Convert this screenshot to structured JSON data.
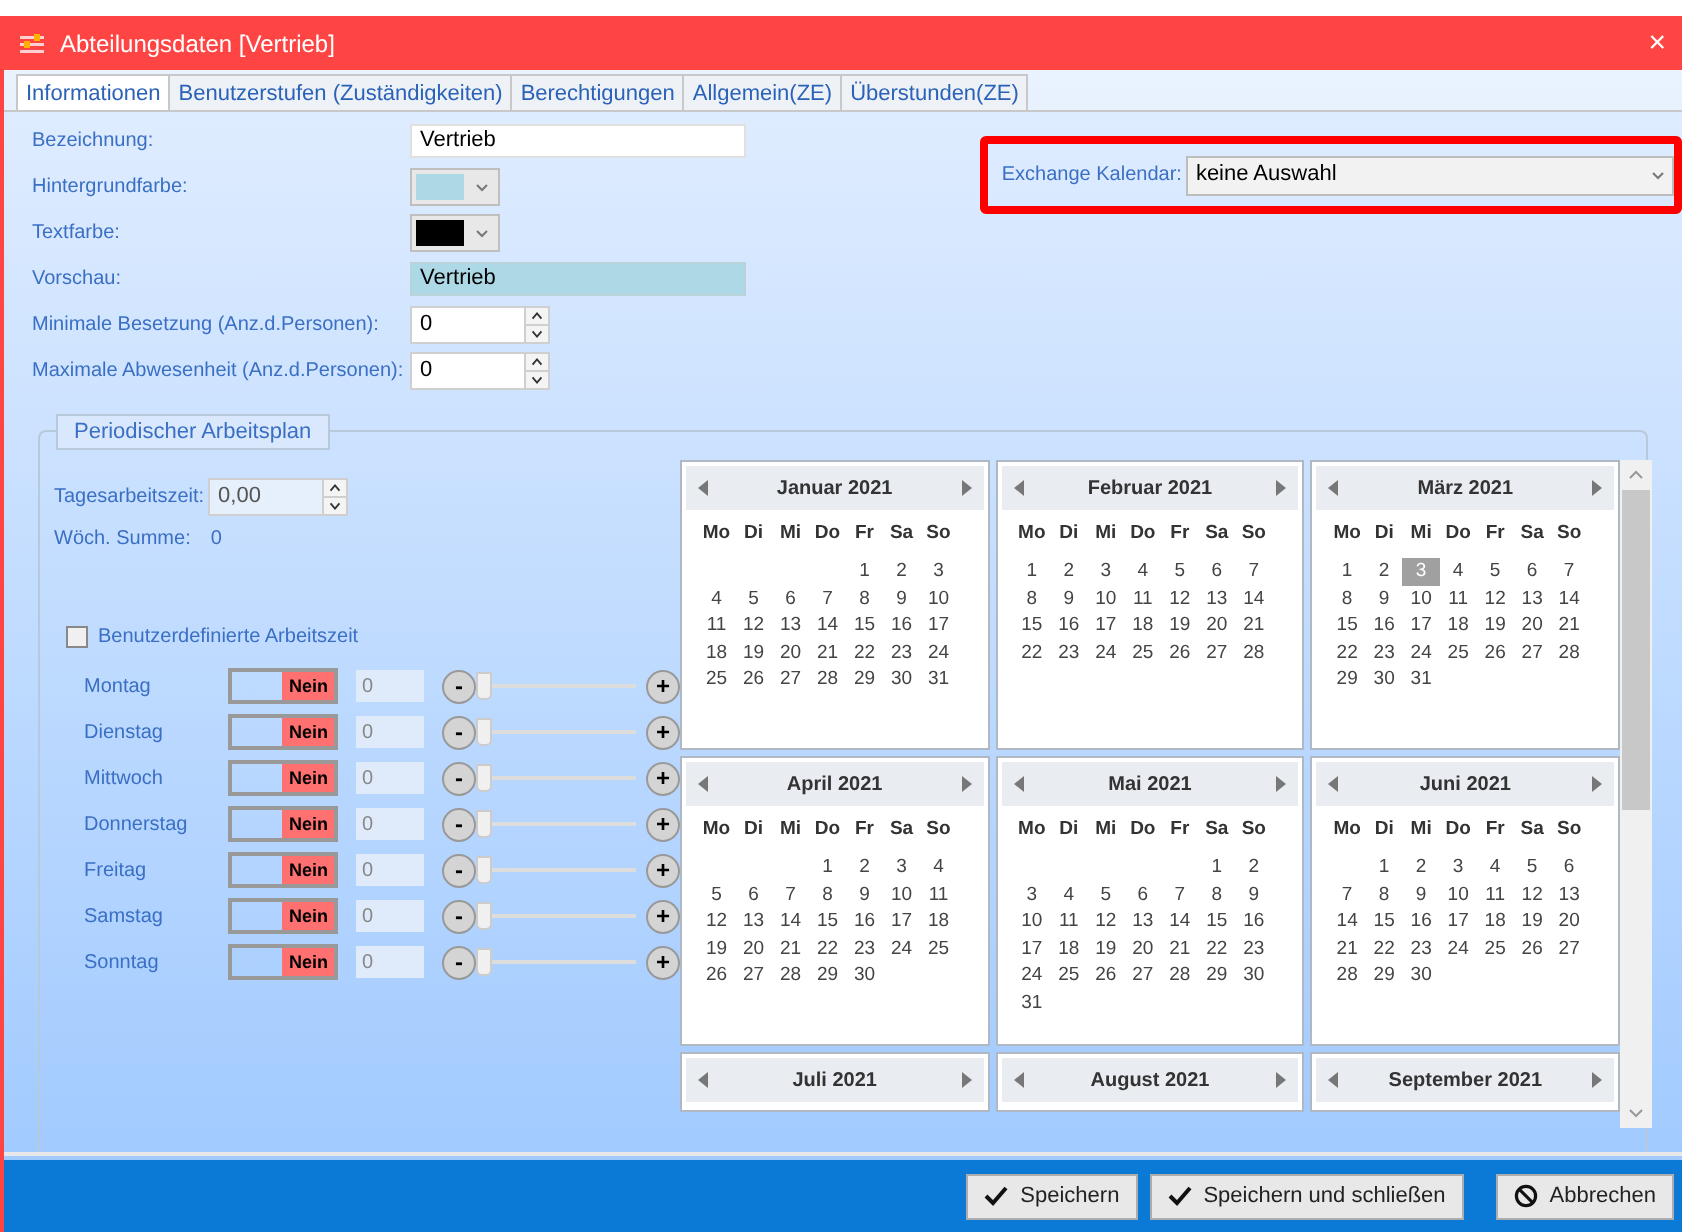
{
  "window": {
    "title": "Abteilungsdaten [Vertrieb]",
    "close": "×"
  },
  "tabs": [
    {
      "label": "Informationen",
      "selected": true
    },
    {
      "label": "Benutzerstufen (Zuständigkeiten)",
      "selected": false
    },
    {
      "label": "Berechtigungen",
      "selected": false
    },
    {
      "label": "Allgemein(ZE)",
      "selected": false
    },
    {
      "label": "Überstunden(ZE)",
      "selected": false
    }
  ],
  "form": {
    "bezeichnung": {
      "label": "Bezeichnung:",
      "value": "Vertrieb"
    },
    "hintergrundfarbe": {
      "label": "Hintergrundfarbe:",
      "color": "#add8e6"
    },
    "textfarbe": {
      "label": "Textfarbe:",
      "color": "#000000"
    },
    "vorschau": {
      "label": "Vorschau:",
      "value": "Vertrieb"
    },
    "min_besetzung": {
      "label": "Minimale Besetzung (Anz.d.Personen):",
      "value": "0"
    },
    "max_abwesenheit": {
      "label": "Maximale Abwesenheit (Anz.d.Personen):",
      "value": "0"
    }
  },
  "exchange": {
    "label": "Exchange Kalendar:",
    "value": "keine Auswahl"
  },
  "arbeitsplan": {
    "title": "Periodischer Arbeitsplan",
    "tagesarbeitszeit": {
      "label": "Tagesarbeitszeit:",
      "value": "0,00"
    },
    "woch_summe": {
      "label": "Wöch. Summe:",
      "value": "0"
    },
    "custom": {
      "label": "Benutzerdefinierte Arbeitszeit",
      "checked": false
    },
    "days": [
      {
        "name": "Montag",
        "on": false,
        "toggle": "Nein",
        "placeholder": "0",
        "minus": "-",
        "plus": "+",
        "level": 0
      },
      {
        "name": "Dienstag",
        "on": false,
        "toggle": "Nein",
        "placeholder": "0",
        "minus": "-",
        "plus": "+",
        "level": 0
      },
      {
        "name": "Mittwoch",
        "on": false,
        "toggle": "Nein",
        "placeholder": "0",
        "minus": "-",
        "plus": "+",
        "level": 0
      },
      {
        "name": "Donnerstag",
        "on": false,
        "toggle": "Nein",
        "placeholder": "0",
        "minus": "-",
        "plus": "+",
        "level": 0
      },
      {
        "name": "Freitag",
        "on": false,
        "toggle": "Nein",
        "placeholder": "0",
        "minus": "-",
        "plus": "+",
        "level": 0
      },
      {
        "name": "Samstag",
        "on": false,
        "toggle": "Nein",
        "placeholder": "0",
        "minus": "-",
        "plus": "+",
        "level": 0
      },
      {
        "name": "Sonntag",
        "on": false,
        "toggle": "Nein",
        "placeholder": "0",
        "minus": "-",
        "plus": "+",
        "level": 0
      }
    ]
  },
  "calendar": {
    "months": [
      {
        "title": "Januar 2021",
        "weekdays": [
          "Mo",
          "Di",
          "Mi",
          "Do",
          "Fr",
          "Sa",
          "So"
        ],
        "weeks": [
          [
            "1",
            "2",
            "3"
          ],
          [
            "4",
            "5",
            "6",
            "7",
            "8",
            "9",
            "10"
          ],
          [
            "11",
            "12",
            "13",
            "14",
            "15",
            "16",
            "17"
          ],
          [
            "18",
            "19",
            "20",
            "21",
            "22",
            "23",
            "24"
          ],
          [
            "25",
            "26",
            "27",
            "28",
            "29",
            "30",
            "31"
          ]
        ]
      },
      {
        "title": "Februar 2021",
        "weekdays": [
          "Mo",
          "Di",
          "Mi",
          "Do",
          "Fr",
          "Sa",
          "So"
        ],
        "weeks": [
          [
            "1",
            "2",
            "3",
            "4",
            "5",
            "6",
            "7"
          ],
          [
            "8",
            "9",
            "10",
            "11",
            "12",
            "13",
            "14"
          ],
          [
            "15",
            "16",
            "17",
            "18",
            "19",
            "20",
            "21"
          ],
          [
            "22",
            "23",
            "24",
            "25",
            "26",
            "27",
            "28"
          ]
        ]
      },
      {
        "title": "März 2021",
        "weekdays": [
          "Mo",
          "Di",
          "Mi",
          "Do",
          "Fr",
          "Sa",
          "So"
        ],
        "weeks": [
          [
            "1",
            "2",
            {
              "day": "3",
              "selected": true
            },
            "4",
            "5",
            "6",
            "7"
          ],
          [
            "8",
            "9",
            "10",
            "11",
            "12",
            "13",
            "14"
          ],
          [
            "15",
            "16",
            "17",
            "18",
            "19",
            "20",
            "21"
          ],
          [
            "22",
            "23",
            "24",
            "25",
            "26",
            "27",
            "28"
          ],
          [
            "29",
            "30",
            "31"
          ]
        ]
      },
      {
        "title": "April 2021",
        "weekdays": [
          "Mo",
          "Di",
          "Mi",
          "Do",
          "Fr",
          "Sa",
          "So"
        ],
        "weeks": [
          [
            "1",
            "2",
            "3",
            "4"
          ],
          [
            "5",
            "6",
            "7",
            "8",
            "9",
            "10",
            "11"
          ],
          [
            "12",
            "13",
            "14",
            "15",
            "16",
            "17",
            "18"
          ],
          [
            "19",
            "20",
            "21",
            "22",
            "23",
            "24",
            "25"
          ],
          [
            "26",
            "27",
            "28",
            "29",
            "30"
          ]
        ]
      },
      {
        "title": "Mai 2021",
        "weekdays": [
          "Mo",
          "Di",
          "Mi",
          "Do",
          "Fr",
          "Sa",
          "So"
        ],
        "weeks": [
          [
            "1",
            "2"
          ],
          [
            "3",
            "4",
            "5",
            "6",
            "7",
            "8",
            "9"
          ],
          [
            "10",
            "11",
            "12",
            "13",
            "14",
            "15",
            "16"
          ],
          [
            "17",
            "18",
            "19",
            "20",
            "21",
            "22",
            "23"
          ],
          [
            "24",
            "25",
            "26",
            "27",
            "28",
            "29",
            "30"
          ],
          [
            "31"
          ]
        ]
      },
      {
        "title": "Juni 2021",
        "weekdays": [
          "Mo",
          "Di",
          "Mi",
          "Do",
          "Fr",
          "Sa",
          "So"
        ],
        "weeks": [
          [
            "1",
            "2",
            "3",
            "4",
            "5",
            "6"
          ],
          [
            "7",
            "8",
            "9",
            "10",
            "11",
            "12",
            "13"
          ],
          [
            "14",
            "15",
            "16",
            "17",
            "18",
            "19",
            "20"
          ],
          [
            "21",
            "22",
            "23",
            "24",
            "25",
            "26",
            "27"
          ],
          [
            "28",
            "29",
            "30"
          ]
        ]
      },
      {
        "title": "Juli 2021"
      },
      {
        "title": "August 2021"
      },
      {
        "title": "September 2021"
      }
    ]
  },
  "buttons": [
    {
      "kind": "check",
      "label": "Speichern"
    },
    {
      "kind": "check",
      "label": "Speichern und schließen"
    },
    {
      "kind": "cancel",
      "label": "Abbrechen"
    }
  ]
}
